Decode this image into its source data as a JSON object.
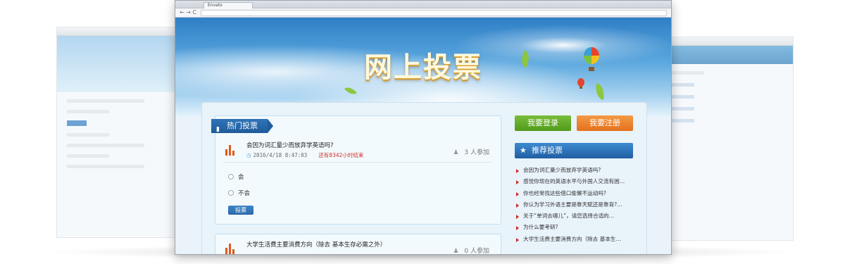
{
  "browser": {
    "tab_title": "Envato",
    "nav_controls": "← → C"
  },
  "banner": {
    "title": "网上投票"
  },
  "hot_votes": {
    "ribbon_label": "热门投票",
    "items": [
      {
        "question": "会因为词汇量少而放弃学英语吗?",
        "date": "2016/4/18 8:47:03",
        "remaining": "还有8342小时结束",
        "participants": "3 人参加",
        "options": [
          "会",
          "不会"
        ],
        "vote_label": "投票"
      },
      {
        "question": "大学生活费主要消费方向（除去 基本生存必需之外）",
        "participants": "0 人参加"
      }
    ]
  },
  "account": {
    "login_label": "我要登录",
    "register_label": "我要注册"
  },
  "recommended": {
    "header": "推荐投票",
    "items": [
      "会因为词汇量少而放弃学英语吗?",
      "感觉你现在的英语水平与外国人交流有困…",
      "你也经常找这些借口偷懒不运动吗?",
      "你认为学习外语主要是靠天赋还是靠背?…",
      "关于“单词去哪儿”，请您选择合适的…",
      "为什么要考研?",
      "大学生活费主要消费方向（除去 基本生…"
    ]
  },
  "colors": {
    "ribbon": "#2f73b7",
    "login": "#63ab29",
    "register": "#ec8430",
    "remaining_text": "#d0302c",
    "bullet": "#d02626"
  }
}
